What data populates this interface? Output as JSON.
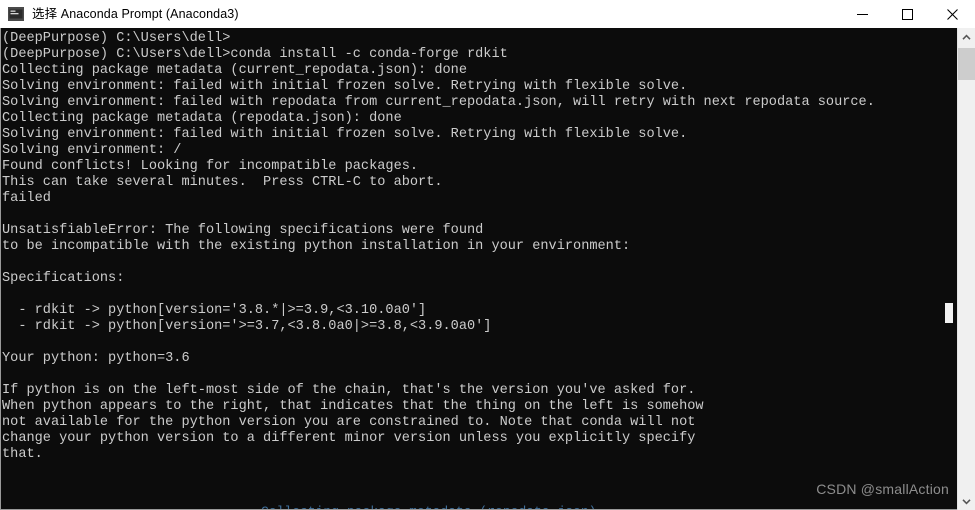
{
  "window": {
    "title": "选择 Anaconda Prompt (Anaconda3)",
    "icon": "console-icon",
    "controls": {
      "minimize": "minimize-icon",
      "maximize": "maximize-icon",
      "close": "close-icon"
    }
  },
  "console": {
    "prompt_env": "(DeepPurpose)",
    "cwd": "C:\\Users\\dell",
    "command": "conda install -c conda-forge rdkit",
    "python_version": "python=3.6",
    "text": "(DeepPurpose) C:\\Users\\dell>\n(DeepPurpose) C:\\Users\\dell>conda install -c conda-forge rdkit\nCollecting package metadata (current_repodata.json): done\nSolving environment: failed with initial frozen solve. Retrying with flexible solve.\nSolving environment: failed with repodata from current_repodata.json, will retry with next repodata source.\nCollecting package metadata (repodata.json): done\nSolving environment: failed with initial frozen solve. Retrying with flexible solve.\nSolving environment: /\nFound conflicts! Looking for incompatible packages.\nThis can take several minutes.  Press CTRL-C to abort.\nfailed\n\nUnsatisfiableError: The following specifications were found\nto be incompatible with the existing python installation in your environment:\n\nSpecifications:\n\n  - rdkit -> python[version='3.8.*|>=3.9,<3.10.0a0']\n  - rdkit -> python[version='>=3.7,<3.8.0a0|>=3.8,<3.9.0a0']\n\nYour python: python=3.6\n\nIf python is on the left-most side of the chain, that's the version you've asked for.\nWhen python appears to the right, that indicates that the thing on the left is somehow\nnot available for the python version you are constrained to. Note that conda will not\nchange your python version to a different minor version unless you explicitly specify\nthat."
  },
  "bottom_clipped_line": "Collecting package metadata (repodata.json)",
  "watermark": "CSDN @smallAction",
  "scrollbar": {
    "up_arrow": "chevron-up-icon",
    "down_arrow": "chevron-down-icon"
  },
  "colors": {
    "console_background": "#0c0c0c",
    "console_text": "#cccccc",
    "titlebar_background": "#ffffff",
    "cursor": "#f2f2f2",
    "watermark": "#8d8d8d"
  }
}
